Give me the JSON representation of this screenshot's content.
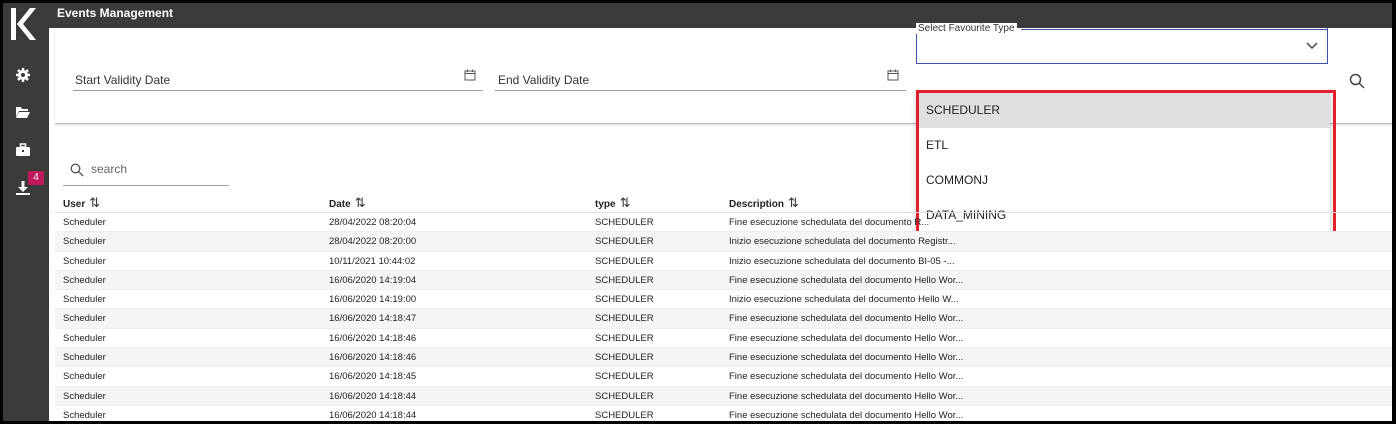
{
  "app": {
    "title": "Events Management",
    "logo_text": "K"
  },
  "sidebar": {
    "icons": [
      {
        "name": "gear-icon"
      },
      {
        "name": "folder-open-icon"
      },
      {
        "name": "briefcase-icon"
      },
      {
        "name": "download-icon"
      }
    ],
    "download_badge": "4"
  },
  "filters": {
    "start_date_label": "Start Validity Date",
    "end_date_label": "End Validity Date",
    "favourite_type_label": "Select Favourite Type",
    "favourite_type_value": ""
  },
  "dropdown": {
    "options": [
      "SCHEDULER",
      "ETL",
      "COMMONJ",
      "DATA_MINING"
    ],
    "hovered": "SCHEDULER"
  },
  "search": {
    "placeholder": "search",
    "value": ""
  },
  "table": {
    "columns": [
      "User",
      "Date",
      "type",
      "Description"
    ],
    "rows": [
      [
        "Scheduler",
        "28/04/2022 08:20:04",
        "SCHEDULER",
        "Fine esecuzione schedulata del documento R..."
      ],
      [
        "Scheduler",
        "28/04/2022 08:20:00",
        "SCHEDULER",
        "Inizio esecuzione schedulata del documento Registr..."
      ],
      [
        "Scheduler",
        "10/11/2021 10:44:02",
        "SCHEDULER",
        "Inizio esecuzione schedulata del documento BI-05 -..."
      ],
      [
        "Scheduler",
        "16/06/2020 14:19:04",
        "SCHEDULER",
        "Fine esecuzione schedulata del documento Hello Wor..."
      ],
      [
        "Scheduler",
        "16/06/2020 14:19:00",
        "SCHEDULER",
        "Inizio esecuzione schedulata del documento Hello W..."
      ],
      [
        "Scheduler",
        "16/06/2020 14:18:47",
        "SCHEDULER",
        "Fine esecuzione schedulata del documento Hello Wor..."
      ],
      [
        "Scheduler",
        "16/06/2020 14:18:46",
        "SCHEDULER",
        "Fine esecuzione schedulata del documento Hello Wor..."
      ],
      [
        "Scheduler",
        "16/06/2020 14:18:46",
        "SCHEDULER",
        "Fine esecuzione schedulata del documento Hello Wor..."
      ],
      [
        "Scheduler",
        "16/06/2020 14:18:45",
        "SCHEDULER",
        "Fine esecuzione schedulata del documento Hello Wor..."
      ],
      [
        "Scheduler",
        "16/06/2020 14:18:44",
        "SCHEDULER",
        "Fine esecuzione schedulata del documento Hello Wor..."
      ],
      [
        "Scheduler",
        "16/06/2020 14:18:44",
        "SCHEDULER",
        "Fine esecuzione schedulata del documento Hello Wor..."
      ]
    ]
  },
  "colors": {
    "sidebar": "#3b3b3b",
    "accent": "#3f51b5",
    "highlight": "#e0202a",
    "badge": "#c2185b"
  }
}
